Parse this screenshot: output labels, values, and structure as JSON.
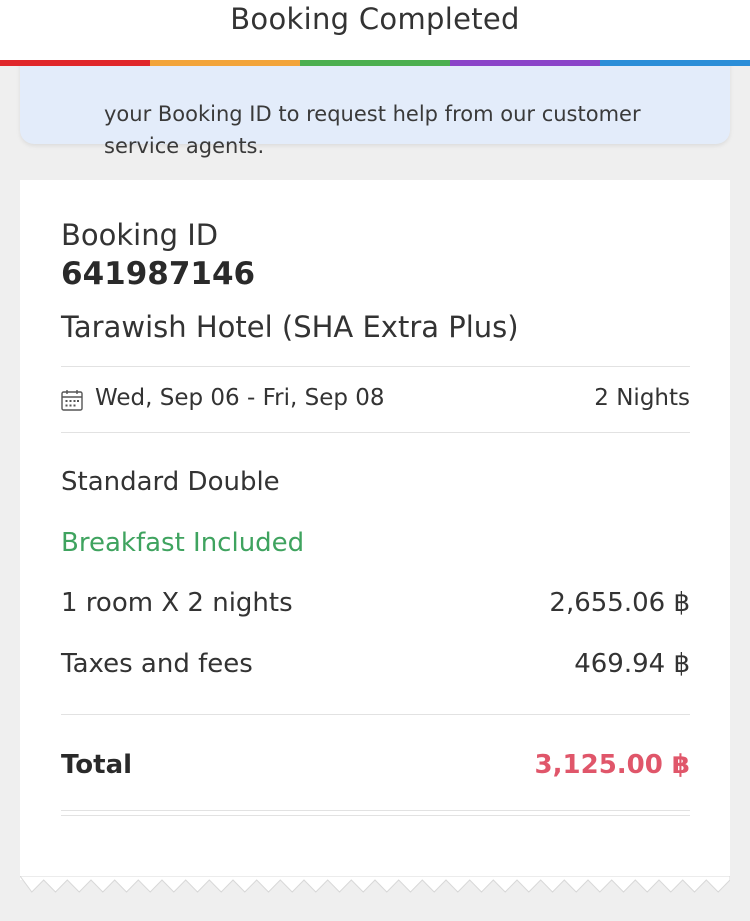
{
  "header": {
    "title": "Booking Completed"
  },
  "brand_strip_colors": [
    "#e0272a",
    "#f2a43a",
    "#4caf50",
    "#8b44c8",
    "#2b8ed8"
  ],
  "notice": {
    "text": "your Booking ID to request help from our customer service agents."
  },
  "booking": {
    "id_label": "Booking ID",
    "id_value": "641987146",
    "hotel_name": "Tarawish Hotel (SHA Extra Plus)",
    "dates": "Wed, Sep 06 - Fri, Sep 08",
    "nights": "2 Nights",
    "calendar_icon": "calendar-icon",
    "room_type": "Standard Double",
    "meal_plan": "Breakfast Included",
    "meal_plan_color": "#3fa35f"
  },
  "price_lines": [
    {
      "label": "1 room  X 2 nights",
      "value": "2,655.06 ฿"
    },
    {
      "label": "Taxes and fees",
      "value": "469.94 ฿"
    }
  ],
  "total": {
    "label": "Total",
    "value": "3,125.00 ฿",
    "color": "#e0566a"
  }
}
